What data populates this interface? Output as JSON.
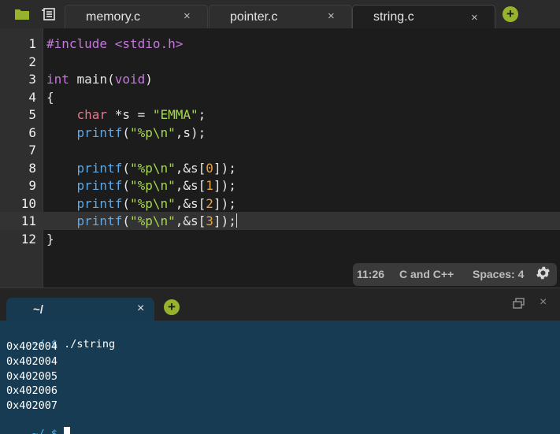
{
  "toolbar": {
    "folder_icon": "folder-icon",
    "files_icon": "file-list-icon"
  },
  "editor_tabs": [
    {
      "label": "memory.c",
      "close": "×",
      "active": false
    },
    {
      "label": "pointer.c",
      "close": "×",
      "active": false
    },
    {
      "label": "string.c",
      "close": "×",
      "active": true
    }
  ],
  "add_tab": "+",
  "editor": {
    "lines": [
      {
        "n": "1",
        "tokens": [
          [
            "kw",
            "#include"
          ],
          [
            "pl",
            " "
          ],
          [
            "kw",
            "<stdio.h>"
          ]
        ]
      },
      {
        "n": "2",
        "tokens": []
      },
      {
        "n": "3",
        "tokens": [
          [
            "kw",
            "int"
          ],
          [
            "pl",
            " "
          ],
          [
            "pl",
            "main("
          ],
          [
            "kw",
            "void"
          ],
          [
            "pl",
            ")"
          ]
        ]
      },
      {
        "n": "4",
        "tokens": [
          [
            "pl",
            "{"
          ]
        ]
      },
      {
        "n": "5",
        "tokens": [
          [
            "pl",
            "    "
          ],
          [
            "ty",
            "char"
          ],
          [
            "pl",
            " *s = "
          ],
          [
            "st",
            "\"EMMA\""
          ],
          [
            "pl",
            ";"
          ]
        ]
      },
      {
        "n": "6",
        "tokens": [
          [
            "pl",
            "    "
          ],
          [
            "fn",
            "printf"
          ],
          [
            "pl",
            "("
          ],
          [
            "st",
            "\"%p\\n\""
          ],
          [
            "pl",
            ",s);"
          ]
        ]
      },
      {
        "n": "7",
        "tokens": []
      },
      {
        "n": "8",
        "tokens": [
          [
            "pl",
            "    "
          ],
          [
            "fn",
            "printf"
          ],
          [
            "pl",
            "("
          ],
          [
            "st",
            "\"%p\\n\""
          ],
          [
            "pl",
            ",&s["
          ],
          [
            "nu",
            "0"
          ],
          [
            "pl",
            "]);"
          ]
        ]
      },
      {
        "n": "9",
        "tokens": [
          [
            "pl",
            "    "
          ],
          [
            "fn",
            "printf"
          ],
          [
            "pl",
            "("
          ],
          [
            "st",
            "\"%p\\n\""
          ],
          [
            "pl",
            ",&s["
          ],
          [
            "nu",
            "1"
          ],
          [
            "pl",
            "]);"
          ]
        ]
      },
      {
        "n": "10",
        "tokens": [
          [
            "pl",
            "    "
          ],
          [
            "fn",
            "printf"
          ],
          [
            "pl",
            "("
          ],
          [
            "st",
            "\"%p\\n\""
          ],
          [
            "pl",
            ",&s["
          ],
          [
            "nu",
            "2"
          ],
          [
            "pl",
            "]);"
          ]
        ]
      },
      {
        "n": "11",
        "tokens": [
          [
            "pl",
            "    "
          ],
          [
            "fn",
            "printf"
          ],
          [
            "pl",
            "("
          ],
          [
            "st",
            "\"%p\\n\""
          ],
          [
            "pl",
            ",&s["
          ],
          [
            "nu",
            "3"
          ],
          [
            "pl",
            "]);"
          ]
        ]
      },
      {
        "n": "12",
        "tokens": [
          [
            "pl",
            "}"
          ]
        ]
      }
    ],
    "active_line": "11"
  },
  "status": {
    "cursor_pos": "11:26",
    "language": "C and C++",
    "spaces": "Spaces: 4",
    "settings_icon": "gear-icon"
  },
  "terminal": {
    "tab_label": "~/",
    "tab_close": "×",
    "add": "+",
    "close": "×",
    "prompt": "~/ $",
    "command": " ./string",
    "output": [
      "0x402004",
      "0x402004",
      "0x402005",
      "0x402006",
      "0x402007"
    ],
    "final_prompt": "~/ $"
  },
  "colors": {
    "accent_green": "#97b32d",
    "string": "#a6d84d",
    "keyword": "#c678dd",
    "function": "#5da8e6",
    "number": "#e8a14a",
    "terminal_bg": "#163b52"
  }
}
